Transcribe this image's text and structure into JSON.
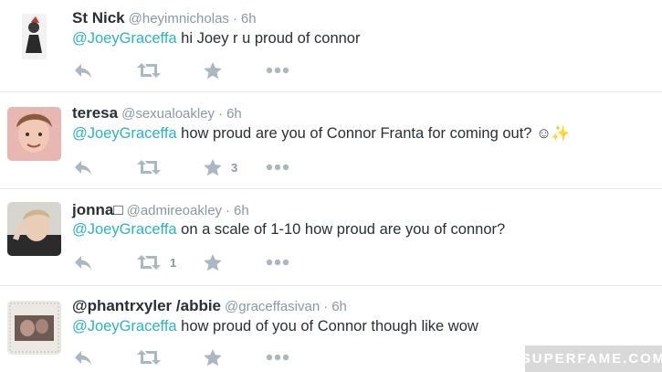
{
  "tweets": [
    {
      "fullname": "St Nick",
      "username": "@heyimnicholas",
      "separator": "·",
      "time": "6h",
      "mention": "@JoeyGraceffa",
      "text": " hi Joey r u proud of connor",
      "retweet_count": "",
      "favorite_count": ""
    },
    {
      "fullname": "teresa",
      "username": "@sexualoakley",
      "separator": "·",
      "time": "6h",
      "mention": "@JoeyGraceffa",
      "text": " how proud are you of Connor Franta for coming out? ☺✨",
      "retweet_count": "",
      "favorite_count": "3"
    },
    {
      "fullname": "jonna□",
      "username": "@admireoakley",
      "separator": "·",
      "time": "6h",
      "mention": "@JoeyGraceffa",
      "text": " on a scale of 1-10 how proud are you of connor?",
      "retweet_count": "1",
      "favorite_count": ""
    },
    {
      "fullname": "@phantrxyler /abbie",
      "username": "@graceffasivan",
      "separator": "·",
      "time": "6h",
      "mention": "@JoeyGraceffa",
      "text": " how proud of you of Connor though like wow",
      "retweet_count": "",
      "favorite_count": ""
    }
  ],
  "icons": {
    "reply": "reply-icon",
    "retweet": "retweet-icon",
    "favorite": "star-icon",
    "more": "more-icon"
  },
  "colors": {
    "mention": "#2ab4c5",
    "muted": "#8899a6",
    "icon": "#aab8c2",
    "text": "#292f33"
  },
  "watermark": "SUPERFAME.COM"
}
